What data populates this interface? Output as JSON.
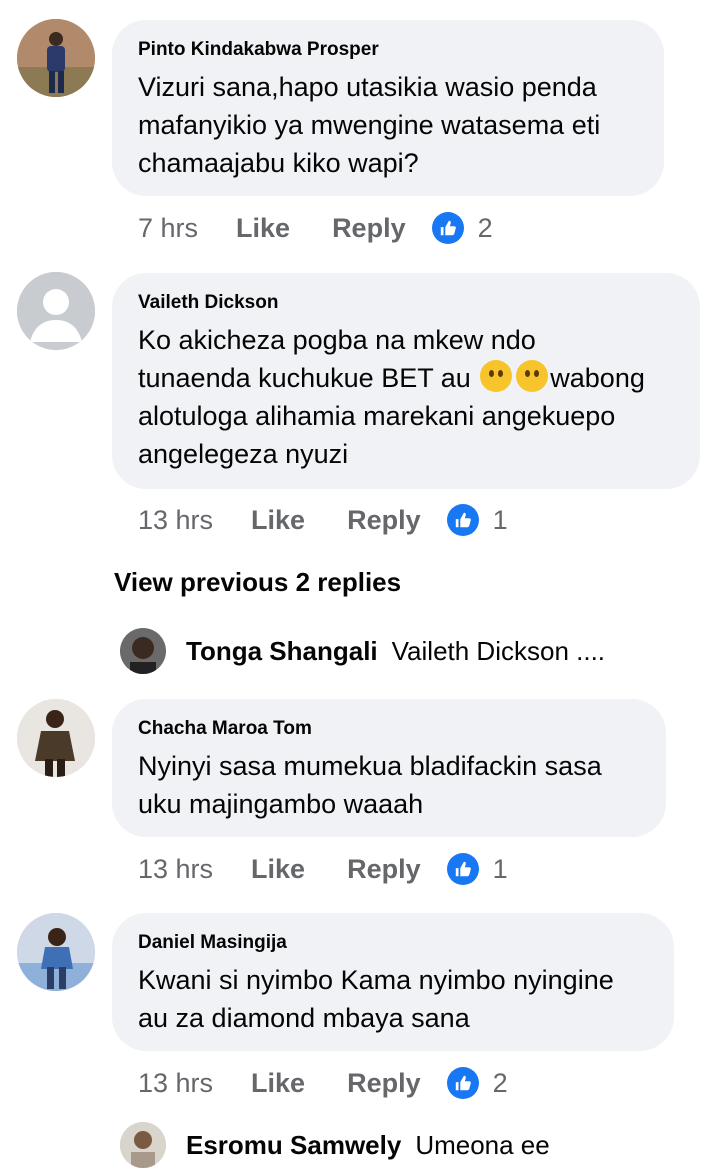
{
  "actions": {
    "like": "Like",
    "reply": "Reply"
  },
  "comments": [
    {
      "author": "Pinto Kindakabwa Prosper",
      "lines": [
        "Vizuri sana,hapo utasikia wasio penda",
        "mafanyikio ya mwengine watasema eti",
        "chamaajabu kiko wapi?"
      ],
      "time": "7 hrs",
      "likes": "2"
    },
    {
      "author": "Vaileth Dickson",
      "lines": [
        "Ko akicheza pogba na mkew ndo",
        "tunaenda kuchukue BET au",
        "wabong",
        "alotuloga alihamia marekani angekuepo",
        "angelegeza nyuzi"
      ],
      "time": "13 hrs",
      "likes": "1"
    },
    {
      "author": "Chacha Maroa Tom",
      "lines": [
        "Nyinyi sasa mumekua bladifackin sasa",
        "uku majingambo waaah"
      ],
      "time": "13 hrs",
      "likes": "1"
    },
    {
      "author": "Daniel Masingija",
      "lines": [
        "Kwani si nyimbo Kama nyimbo nyingine",
        "au za diamond mbaya sana"
      ],
      "time": "13 hrs",
      "likes": "2"
    }
  ],
  "view_previous": "View previous 2 replies",
  "replies": [
    {
      "author": "Tonga Shangali",
      "text": "Vaileth Dickson ...."
    },
    {
      "author": "Esromu Samwely",
      "text": "Umeona ee"
    }
  ],
  "emoji_icons": [
    "thinking-face-icon",
    "thinking-face-icon"
  ],
  "like_icon_color": "#1877f2",
  "bubble_color": "#f0f2f5"
}
